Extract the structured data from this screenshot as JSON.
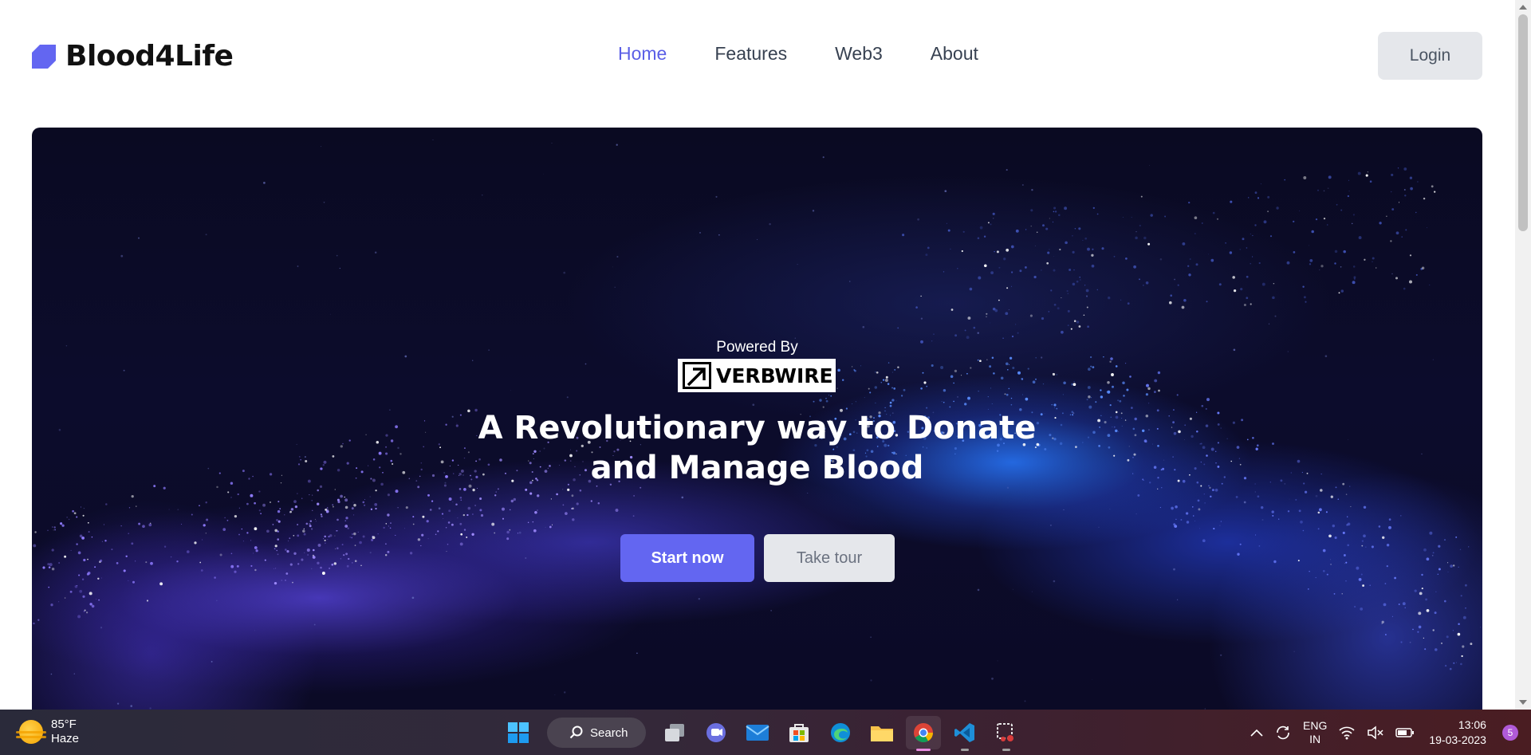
{
  "header": {
    "brand": "Blood4Life",
    "nav": [
      {
        "label": "Home",
        "active": true
      },
      {
        "label": "Features",
        "active": false
      },
      {
        "label": "Web3",
        "active": false
      },
      {
        "label": "About",
        "active": false
      }
    ],
    "login_label": "Login"
  },
  "hero": {
    "powered_by": "Powered By",
    "partner_logo_text": "VERBWIRE",
    "headline_line1": "A Revolutionary way to Donate",
    "headline_line2": "and Manage Blood",
    "primary_cta": "Start now",
    "secondary_cta": "Take tour"
  },
  "colors": {
    "accent": "#6366f1",
    "nav_active": "#5b5fe6",
    "button_gray": "#e5e7eb"
  },
  "taskbar": {
    "weather_temp": "85°F",
    "weather_desc": "Haze",
    "search_label": "Search",
    "apps": [
      "windows-start-icon",
      "search",
      "task-view-icon",
      "teams-chat-icon",
      "mail-icon",
      "microsoft-store-icon",
      "edge-icon",
      "file-explorer-icon",
      "chrome-icon",
      "vscode-icon",
      "snipping-tool-icon"
    ],
    "lang_line1": "ENG",
    "lang_line2": "IN",
    "time": "13:06",
    "date": "19-03-2023",
    "notification_count": "5"
  }
}
